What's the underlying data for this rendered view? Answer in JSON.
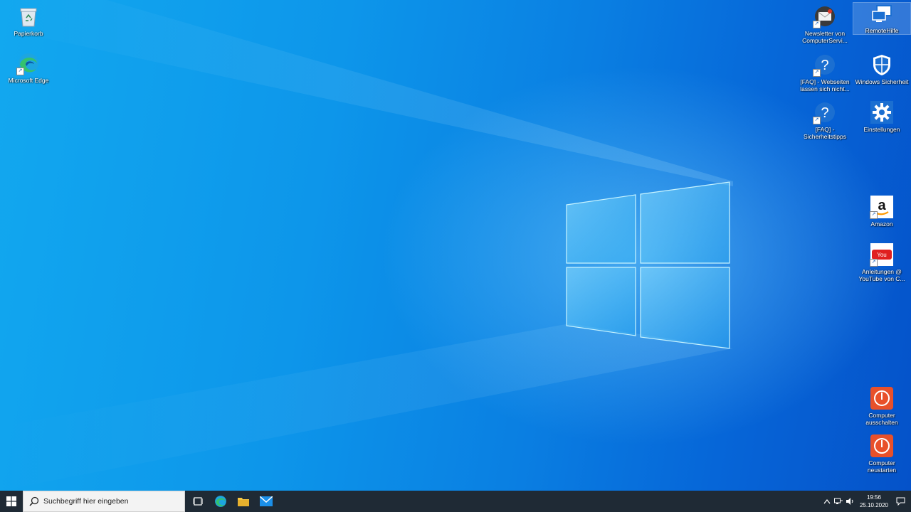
{
  "desktop_icons_left": [
    {
      "label": "Papierkorb",
      "icon": "recycle-bin-icon"
    },
    {
      "label": "Microsoft Edge",
      "icon": "edge-icon"
    }
  ],
  "desktop_icons_right": [
    {
      "label": "Newsletter von ComputerServi...",
      "icon": "mail-icon"
    },
    {
      "label": "RemoteHilfe",
      "icon": "remote-help-icon"
    },
    {
      "label": "[FAQ] - Webseiten lassen sich nicht...",
      "icon": "help-icon"
    },
    {
      "label": "Windows Sicherheit",
      "icon": "shield-icon"
    },
    {
      "label": "[FAQ] - Sicherheitstipps",
      "icon": "help-icon"
    },
    {
      "label": "Einstellungen",
      "icon": "gear-icon"
    },
    {
      "label": "Amazon",
      "icon": "amazon-icon"
    },
    {
      "label": "Anleitungen @ YouTube von C...",
      "icon": "youtube-icon"
    },
    {
      "label": "Computer ausschalten",
      "icon": "power-icon"
    },
    {
      "label": "Computer neustarten",
      "icon": "power-icon"
    }
  ],
  "taskbar": {
    "search_placeholder": "Suchbegriff hier eingeben",
    "clock_time": "19:56",
    "clock_date": "25.10.2020"
  },
  "colors": {
    "taskbar": "#1f2a35",
    "accent": "#0a78d7",
    "power_red": "#e8502a"
  }
}
